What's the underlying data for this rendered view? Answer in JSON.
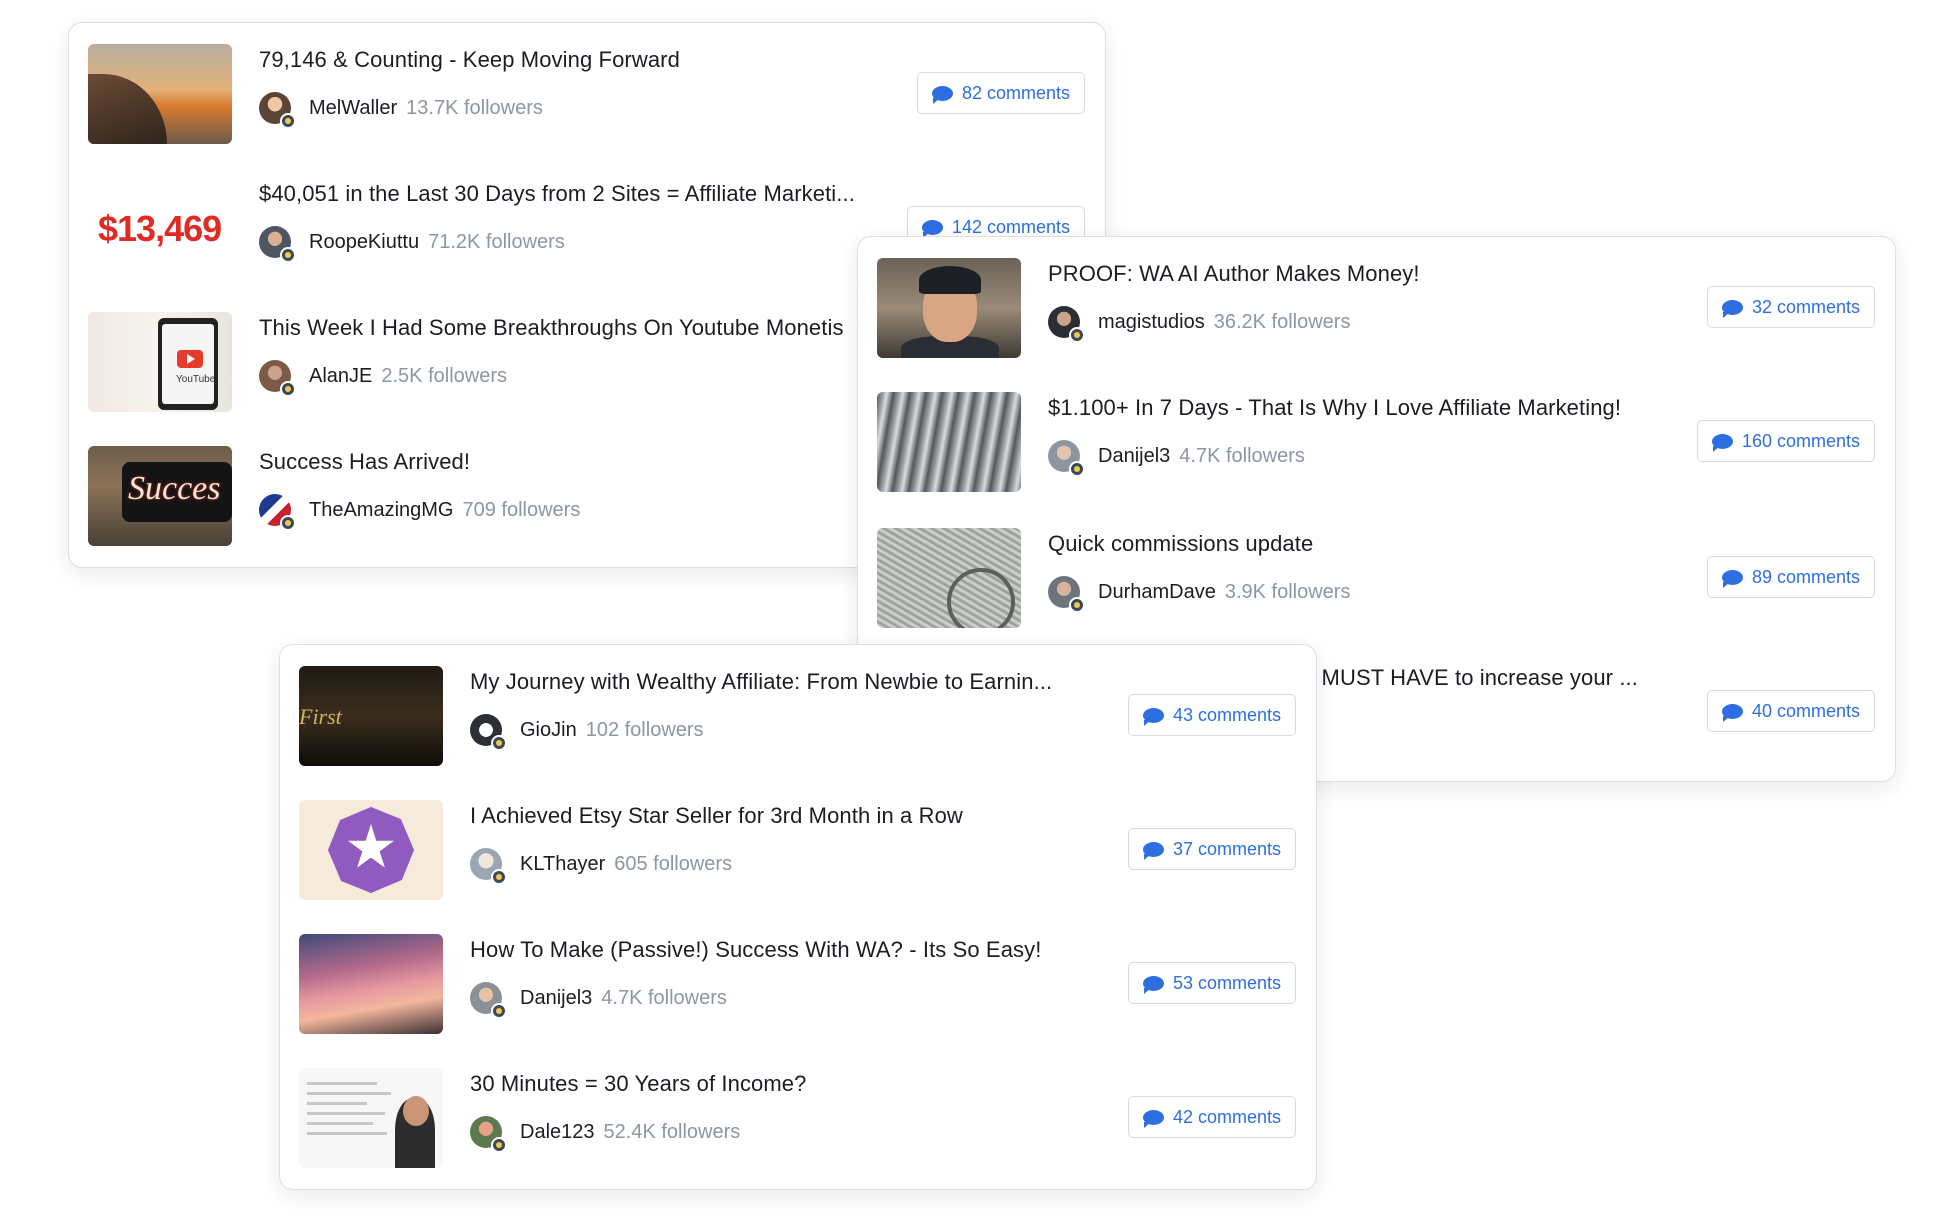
{
  "card_a": {
    "posts": [
      {
        "title": "79,146 & Counting - Keep Moving Forward",
        "username": "MelWaller",
        "followers": "13.7K followers",
        "comments": "82 comments"
      },
      {
        "title": "$40,051 in the Last 30 Days from 2 Sites = Affiliate Marketi...",
        "username": "RoopeKiuttu",
        "followers": "71.2K followers",
        "comments": "142 comments",
        "thumb_text": "$13,469"
      },
      {
        "title": "This Week I Had Some Breakthroughs On Youtube Monetis",
        "username": "AlanJE",
        "followers": "2.5K followers",
        "thumb_text": "YouTube"
      },
      {
        "title": "Success Has Arrived!",
        "username": "TheAmazingMG",
        "followers": "709 followers",
        "thumb_text": "Succes"
      }
    ]
  },
  "card_b": {
    "posts": [
      {
        "title": "PROOF: WA AI Author Makes Money!",
        "username": "magistudios",
        "followers": "36.2K followers",
        "comments": "32 comments"
      },
      {
        "title": "$1.100+ In 7 Days - That Is Why I Love Affiliate Marketing!",
        "username": "Danijel3",
        "followers": "4.7K followers",
        "comments": "160 comments"
      },
      {
        "title": "Quick commissions update",
        "username": "DurhamDave",
        "followers": "3.9K followers",
        "comments": "89 comments"
      },
      {
        "title": "a MUST HAVE to increase your ...",
        "comments": "40 comments"
      }
    ]
  },
  "card_c": {
    "posts": [
      {
        "title": "My Journey with Wealthy Affiliate: From Newbie to Earnin...",
        "username": "GioJin",
        "followers": "102 followers",
        "comments": "43 comments",
        "thumb_text": "First"
      },
      {
        "title": "I Achieved Etsy Star Seller for 3rd Month in a Row",
        "username": "KLThayer",
        "followers": "605 followers",
        "comments": "37 comments"
      },
      {
        "title": "How To Make (Passive!) Success With WA? - Its So Easy!",
        "username": "Danijel3",
        "followers": "4.7K followers",
        "comments": "53 comments"
      },
      {
        "title": "30 Minutes = 30 Years of Income?",
        "username": "Dale123",
        "followers": "52.4K followers",
        "comments": "42 comments"
      }
    ]
  },
  "icons": {
    "comment": "speech-bubble-icon",
    "badge": "member-badge-icon"
  },
  "colors": {
    "accent": "#2d6fe0",
    "title_text": "#1a1d22",
    "muted_text": "#8e96a3",
    "card_border": "#dcdfe4"
  }
}
